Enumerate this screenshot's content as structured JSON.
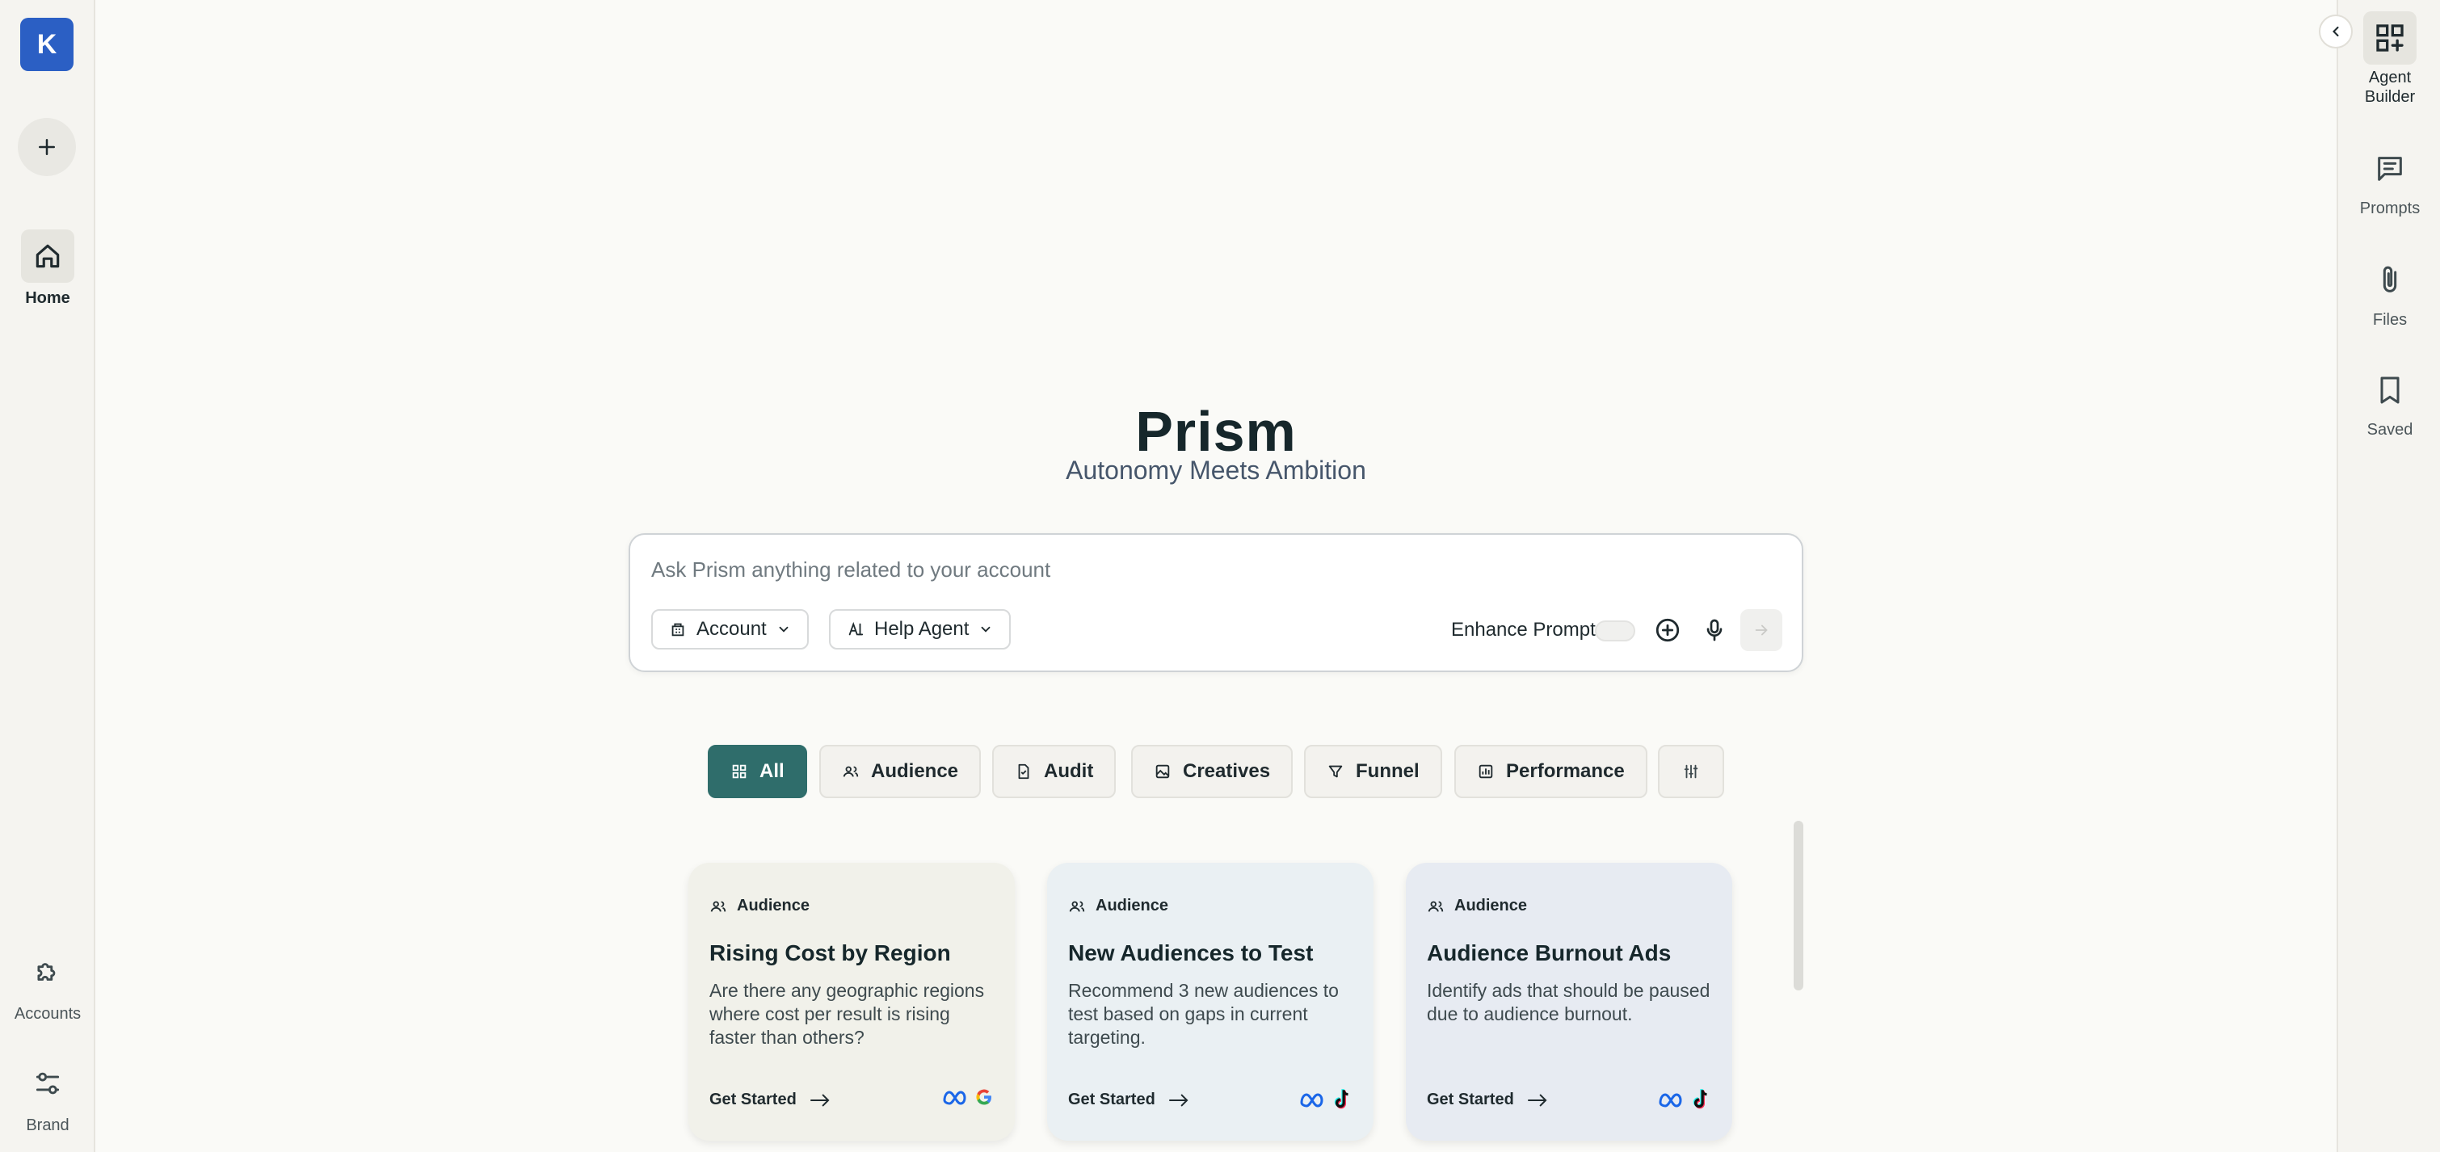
{
  "app": {
    "logo_letter": "K",
    "brand_color": "#2b5fc4",
    "accent_color": "#2f6d6b"
  },
  "left_nav": {
    "new_icon": "plus-icon",
    "items": [
      {
        "label": "Home",
        "icon": "home-icon",
        "active": true
      },
      {
        "label": "Accounts",
        "icon": "puzzle-icon",
        "active": false
      },
      {
        "label": "Brand",
        "icon": "sliders-icon",
        "active": false
      }
    ]
  },
  "right_nav": {
    "collapse_icon": "chevron-left-icon",
    "items": [
      {
        "label_line1": "Agent",
        "label_line2": "Builder",
        "icon": "grid-plus-icon",
        "active": true
      },
      {
        "label_line1": "Prompts",
        "label_line2": "",
        "icon": "chat-list-icon",
        "active": false
      },
      {
        "label_line1": "Files",
        "label_line2": "",
        "icon": "paperclip-icon",
        "active": false
      },
      {
        "label_line1": "Saved",
        "label_line2": "",
        "icon": "bookmark-icon",
        "active": false
      }
    ]
  },
  "hero": {
    "title": "Prism",
    "subtitle": "Autonomy Meets Ambition"
  },
  "prompt": {
    "placeholder": "Ask Prism anything related to your account",
    "account_label": "Account",
    "agent_label": "Help Agent",
    "enhance_label": "Enhance Prompt",
    "enhance_enabled": false
  },
  "filters": [
    {
      "label": "All",
      "icon": "grid-icon",
      "active": true
    },
    {
      "label": "Audience",
      "icon": "people-icon",
      "active": false
    },
    {
      "label": "Audit",
      "icon": "document-icon",
      "active": false
    },
    {
      "label": "Creatives",
      "icon": "image-icon",
      "active": false
    },
    {
      "label": "Funnel",
      "icon": "filter-icon",
      "active": false
    },
    {
      "label": "Performance",
      "icon": "chart-icon",
      "active": false
    },
    {
      "label": "",
      "icon": "settings-sliders-icon",
      "active": false
    }
  ],
  "cards": [
    {
      "tag": "Audience",
      "title": "Rising Cost by Region",
      "description": "Are there any geographic regions where cost per result is rising faster than others?",
      "cta": "Get Started",
      "bg": "#f1f1ea",
      "platforms": [
        "meta-icon",
        "google-icon"
      ]
    },
    {
      "tag": "Audience",
      "title": "New Audiences to Test",
      "description": "Recommend 3 new audiences to test based on gaps in current targeting.",
      "cta": "Get Started",
      "bg": "#eaf0f3",
      "platforms": [
        "meta-icon",
        "tiktok-icon"
      ]
    },
    {
      "tag": "Audience",
      "title": "Audience Burnout Ads",
      "description": "Identify ads that should be paused due to audience burnout.",
      "cta": "Get Started",
      "bg": "#e7ebf2",
      "platforms": [
        "meta-icon",
        "tiktok-icon"
      ]
    }
  ]
}
